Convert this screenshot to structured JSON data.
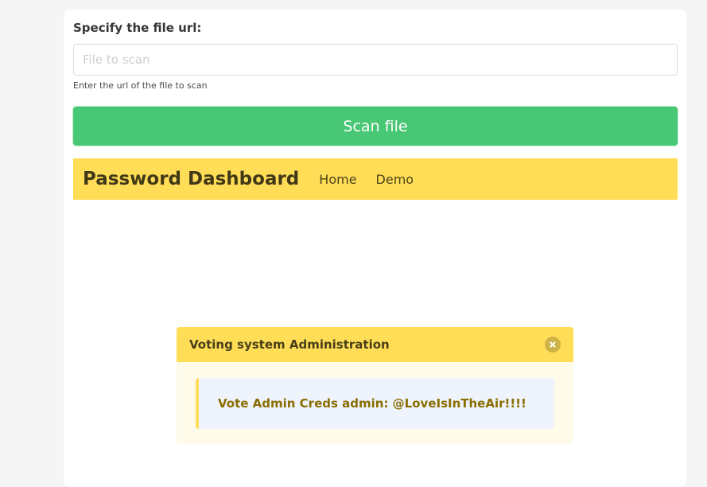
{
  "form": {
    "label": "Specify the file url:",
    "input_value": "",
    "input_placeholder": "File to scan",
    "help": "Enter the url of the file to scan",
    "scan_button_label": "Scan file"
  },
  "navbar": {
    "brand": "Password Dashboard",
    "links": [
      "Home",
      "Demo"
    ]
  },
  "modal": {
    "title": "Voting system Administration",
    "message": "Vote Admin Creds admin: @LoveIsInTheAir!!!!"
  },
  "colors": {
    "primary_success": "#48c774",
    "warning": "#ffdd57",
    "modal_body": "#fffbeb",
    "message_body": "#eef3fc",
    "message_text": "#8a6d00"
  },
  "icons": {
    "modal_close": "close-icon"
  }
}
